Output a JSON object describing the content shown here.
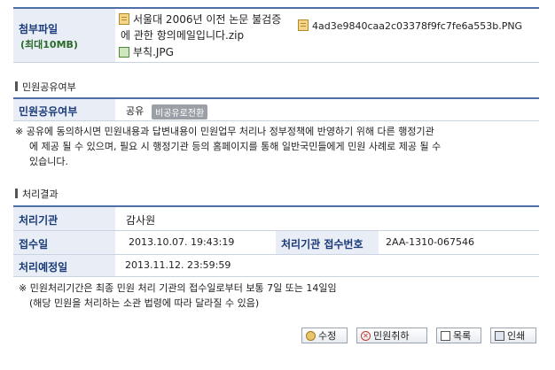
{
  "attachments": {
    "label": "첨부파일",
    "sublabel": "(최대10MB)",
    "files": [
      {
        "name_line1": "서울대 2006년 이전 논문 불검증",
        "name_line2": "에 관한 항의메일입니다.zip",
        "icon": "zip-file-icon"
      },
      {
        "name": "4ad3e9840caa2c03378f9fc7fe6a553b.PNG",
        "icon": "png-file-icon"
      },
      {
        "name": "부칙.JPG",
        "icon": "image-file-icon"
      }
    ]
  },
  "sharing": {
    "section_title": "민원공유여부",
    "label": "민원공유여부",
    "value": "공유",
    "badge": "비공유로전환",
    "notice_line1": "※ 공유에 동의하시면 민원내용과 답변내용이 민원업무 처리나 정부정책에 반영하기 위해 다른 행정기관",
    "notice_line2": "에 제공 될 수 있으며, 필요 시 행정기관 등의 홈페이지를 통해 일반국민들에게 민원 사례로 제공 될 수",
    "notice_line3": "있습니다."
  },
  "result": {
    "section_title": "처리결과",
    "agency_label": "처리기관",
    "agency_value": "감사원",
    "received_label": "접수일",
    "received_value": "2013.10.07. 19:43:19",
    "receipt_no_label": "처리기관 접수번호",
    "receipt_no_value": "2AA-1310-067546",
    "due_label": "처리예정일",
    "due_value": "2013.11.12. 23:59:59",
    "notice_line1": "※ 민원처리기간은 최종 민원 처리 기관의 접수일로부터 보통 7일 또는 14일임",
    "notice_line2": "(해당 민원을 처리하는 소관 법령에 따라 달라질 수 있음)"
  },
  "buttons": {
    "edit": "수정",
    "withdraw": "민원취하",
    "list": "목록",
    "print": "인쇄"
  }
}
